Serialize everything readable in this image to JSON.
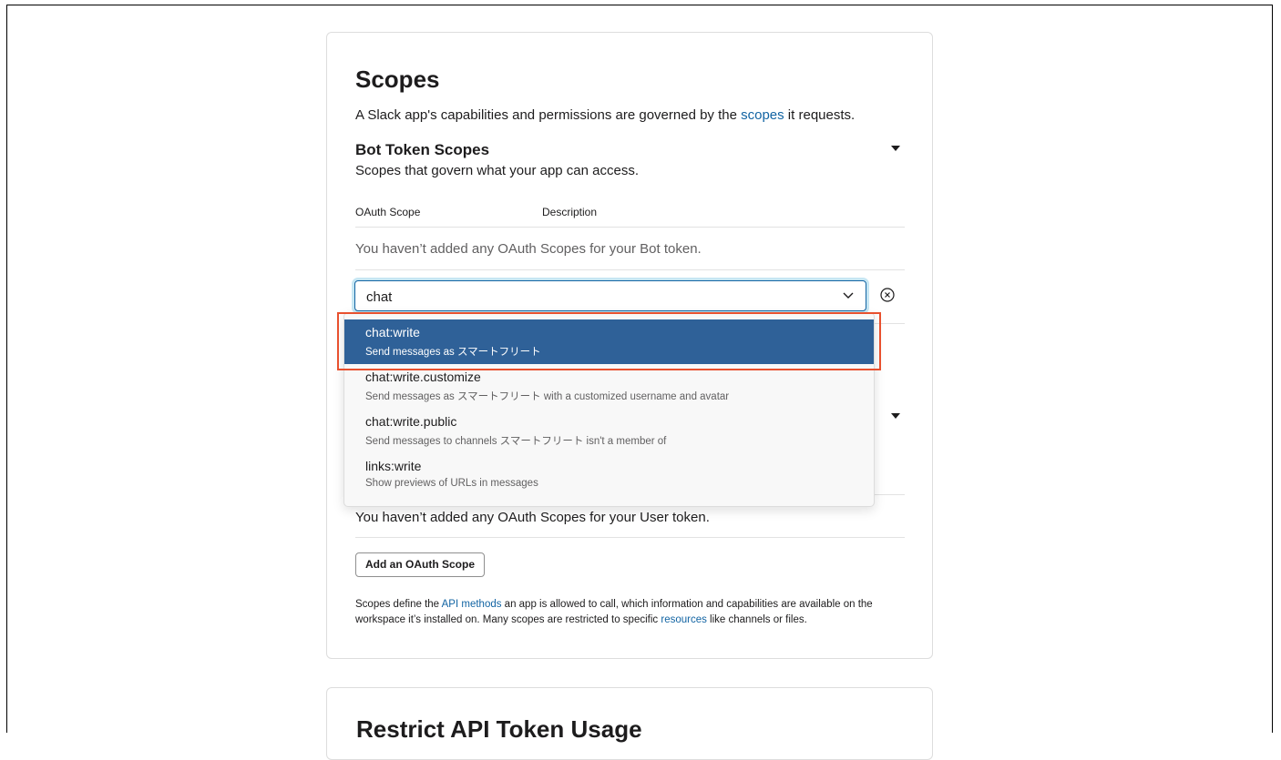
{
  "scopes": {
    "title": "Scopes",
    "intro_before": "A Slack app's capabilities and permissions are governed by the ",
    "intro_link": "scopes",
    "intro_after": " it requests."
  },
  "bot": {
    "title": "Bot Token Scopes",
    "subtitle": "Scopes that govern what your app can access.",
    "col_scope": "OAuth Scope",
    "col_desc": "Description",
    "empty_text": "You haven’t added any OAuth Scopes for your Bot token.",
    "select_value": "chat"
  },
  "dropdown": {
    "options": [
      {
        "name": "chat:write",
        "desc": "Send messages as スマートフリート",
        "selected": true
      },
      {
        "name": "chat:write.customize",
        "desc": "Send messages as スマートフリート with a customized username and avatar",
        "selected": false
      },
      {
        "name": "chat:write.public",
        "desc": "Send messages to channels スマートフリート isn't a member of",
        "selected": false
      },
      {
        "name": "links:write",
        "desc": "Show previews of URLs in messages",
        "selected": false
      }
    ],
    "highlight_color": "#e8502e",
    "selected_bg": "#2f6198"
  },
  "user": {
    "empty_text": "You haven’t added any OAuth Scopes for your User token.",
    "add_button": "Add an OAuth Scope"
  },
  "footer": {
    "p1": "Scopes define the ",
    "link1": "API methods",
    "p2": " an app is allowed to call, which information and capabilities are available on the workspace it’s installed on. Many scopes are restricted to specific ",
    "link2": "resources",
    "p3": " like channels or files."
  },
  "next_section": {
    "title": "Restrict API Token Usage"
  },
  "colors": {
    "link": "#1264a3",
    "focus_border": "#1264a3"
  }
}
